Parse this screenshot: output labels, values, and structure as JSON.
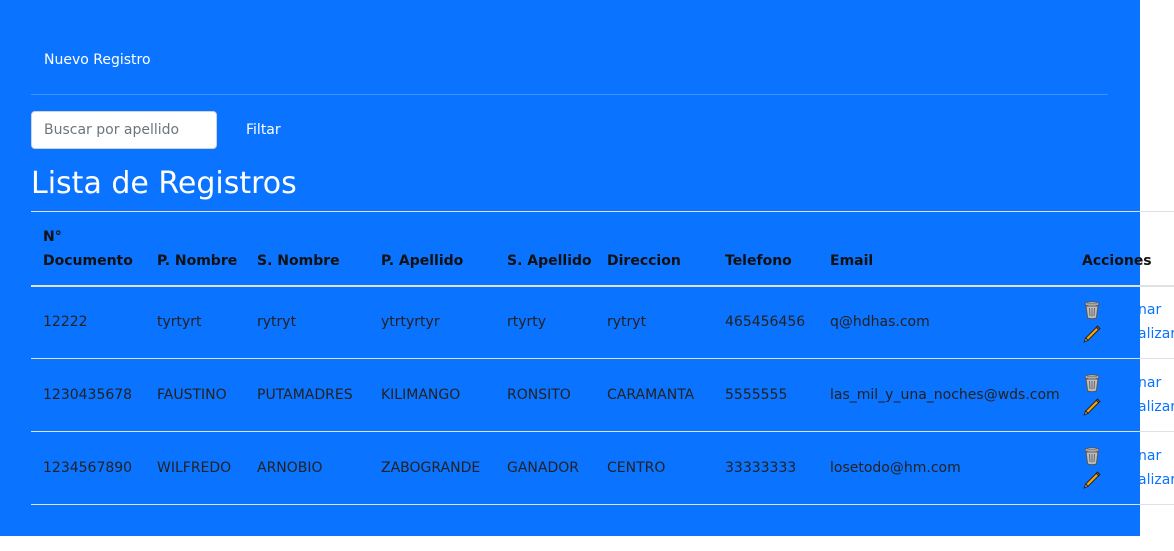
{
  "nav": {
    "new_record": "Nuevo Registro"
  },
  "search": {
    "placeholder": "Buscar por apellido",
    "button": "Filtar"
  },
  "title": "Lista de Registros",
  "table": {
    "headers": {
      "documento": "N° Documento",
      "p_nombre": "P. Nombre",
      "s_nombre": "S. Nombre",
      "p_apellido": "P. Apellido",
      "s_apellido": "S. Apellido",
      "direccion": "Direccion",
      "telefono": "Telefono",
      "email": "Email",
      "acciones": "Acciones"
    },
    "rows": [
      {
        "documento": "12222",
        "p_nombre": "tyrtyrt",
        "s_nombre": "rytryt",
        "p_apellido": "ytrtyrtyr",
        "s_apellido": "rtyrty",
        "direccion": "rytryt",
        "telefono": "465456456",
        "email": "q@hdhas.com"
      },
      {
        "documento": "1230435678",
        "p_nombre": "FAUSTINO",
        "s_nombre": "PUTAMADRES",
        "p_apellido": "KILIMANGO",
        "s_apellido": "RONSITO",
        "direccion": "CARAMANTA",
        "telefono": "5555555",
        "email": "las_mil_y_una_noches@wds.com"
      },
      {
        "documento": "1234567890",
        "p_nombre": "WILFREDO",
        "s_nombre": "ARNOBIO",
        "p_apellido": "ZABOGRANDE",
        "s_apellido": "GANADOR",
        "direccion": "CENTRO",
        "telefono": "33333333",
        "email": "losetodo@hm.com"
      }
    ],
    "delete_label": "nar",
    "update_label": "alizar"
  },
  "icons": {
    "delete": "trash-icon",
    "edit": "pencil-icon"
  },
  "colors": {
    "panel": "#0a73ff",
    "white": "#ffffff",
    "link": "#0a73ff"
  }
}
